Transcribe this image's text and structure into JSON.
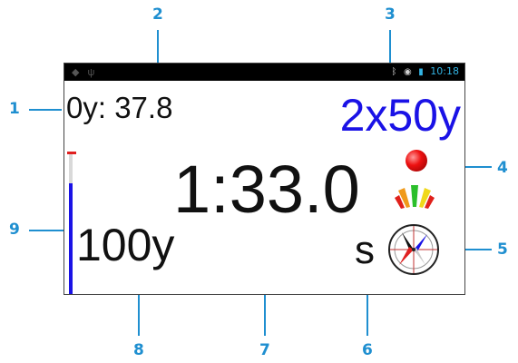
{
  "callouts": {
    "c1": "1",
    "c2": "2",
    "c3": "3",
    "c4": "4",
    "c5": "5",
    "c6": "6",
    "c7": "7",
    "c8": "8",
    "c9": "9"
  },
  "statusbar": {
    "time": "10:18",
    "icons": [
      "android-debug-icon",
      "usb-icon",
      "bluetooth-icon",
      "wifi-icon",
      "battery-icon"
    ]
  },
  "screen": {
    "split_label": "0y: 37.8",
    "set_label": "2x50y",
    "elapsed_time": "1:33.0",
    "distance_label": "100y",
    "stroke_label": "s",
    "progress_fraction": 0.79
  },
  "colors": {
    "accent": "#1a12e6",
    "callout": "#1f8fd0",
    "record_red": "#ee1111",
    "marker_red": "#e02020"
  }
}
